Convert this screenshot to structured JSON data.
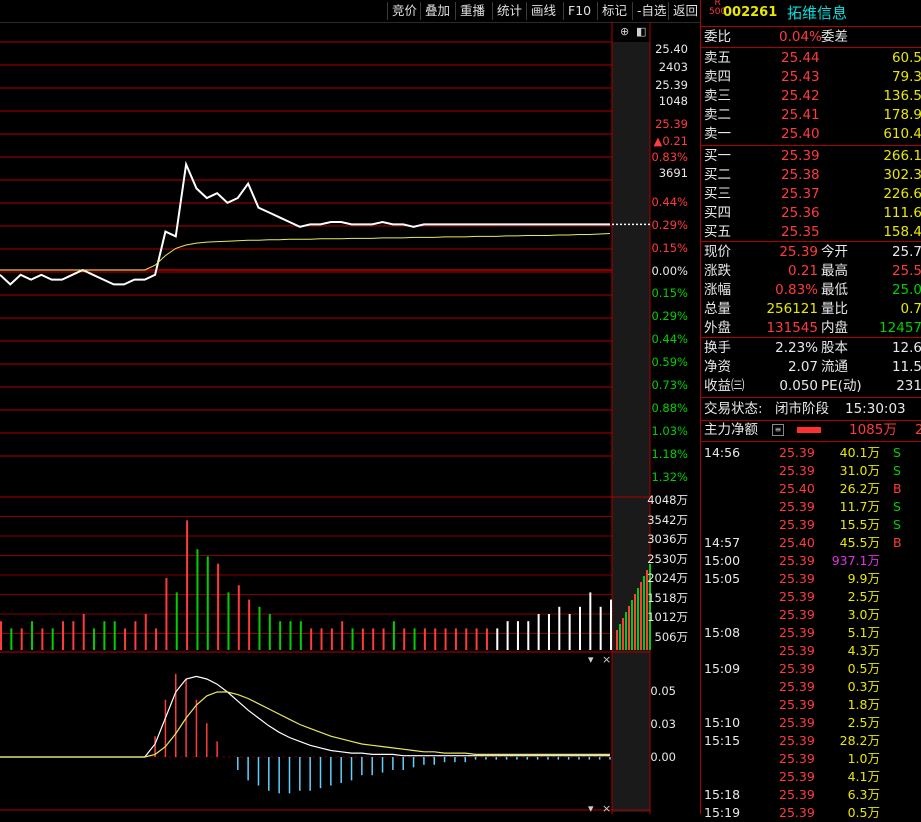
{
  "toolbar": {
    "items": [
      "竞价",
      "叠加",
      "重播",
      "统计",
      "画线",
      "F10",
      "标记",
      "-自选",
      "返回"
    ]
  },
  "stock": {
    "badge_top": "R",
    "badge_bottom": "500",
    "code": "002261",
    "name": "拓维信息"
  },
  "weibi": {
    "label": "委比",
    "value": "0.04%",
    "label2": "委差"
  },
  "asks": [
    {
      "label": "卖五",
      "price": "25.44",
      "vol": "60.5"
    },
    {
      "label": "卖四",
      "price": "25.43",
      "vol": "79.3"
    },
    {
      "label": "卖三",
      "price": "25.42",
      "vol": "136.5"
    },
    {
      "label": "卖二",
      "price": "25.41",
      "vol": "178.9"
    },
    {
      "label": "卖一",
      "price": "25.40",
      "vol": "610.4"
    }
  ],
  "bids": [
    {
      "label": "买一",
      "price": "25.39",
      "vol": "266.1"
    },
    {
      "label": "买二",
      "price": "25.38",
      "vol": "302.3"
    },
    {
      "label": "买三",
      "price": "25.37",
      "vol": "226.6"
    },
    {
      "label": "买四",
      "price": "25.36",
      "vol": "111.6"
    },
    {
      "label": "买五",
      "price": "25.35",
      "vol": "158.4"
    }
  ],
  "quote": [
    {
      "l1": "现价",
      "v1": "25.39",
      "l2": "今开",
      "v2": "25.7",
      "c1": "red",
      "c2": "white"
    },
    {
      "l1": "涨跌",
      "v1": "0.21",
      "l2": "最高",
      "v2": "25.5",
      "c1": "red",
      "c2": "red"
    },
    {
      "l1": "涨幅",
      "v1": "0.83%",
      "l2": "最低",
      "v2": "25.0",
      "c1": "red",
      "c2": "green"
    },
    {
      "l1": "总量",
      "v1": "256121",
      "l2": "量比",
      "v2": "0.7",
      "c1": "yellow",
      "c2": "yellow"
    },
    {
      "l1": "外盘",
      "v1": "131545",
      "l2": "内盘",
      "v2": "12457",
      "c1": "red",
      "c2": "green"
    }
  ],
  "fund": [
    {
      "l1": "换手",
      "v1": "2.23%",
      "l2": "股本",
      "v2": "12.6"
    },
    {
      "l1": "净资",
      "v1": "2.07",
      "l2": "流通",
      "v2": "11.5"
    },
    {
      "l1": "收益㈢",
      "v1": "0.050",
      "l2": "PE(动)",
      "v2": "231"
    }
  ],
  "status": {
    "label": "交易状态:",
    "value": "闭市阶段",
    "time": "15:30:03"
  },
  "mainflow": {
    "label": "主力净额",
    "value": "1085万",
    "extra": "2"
  },
  "ticks": [
    {
      "t": "14:56",
      "p": "25.39",
      "v": "40.1万",
      "bs": "S",
      "pc": "red",
      "vc": "yellow",
      "bc": "green"
    },
    {
      "t": "",
      "p": "25.39",
      "v": "31.0万",
      "bs": "S",
      "pc": "red",
      "vc": "yellow",
      "bc": "green"
    },
    {
      "t": "",
      "p": "25.40",
      "v": "26.2万",
      "bs": "B",
      "pc": "red",
      "vc": "yellow",
      "bc": "red"
    },
    {
      "t": "",
      "p": "25.39",
      "v": "11.7万",
      "bs": "S",
      "pc": "red",
      "vc": "yellow",
      "bc": "green"
    },
    {
      "t": "",
      "p": "25.39",
      "v": "15.5万",
      "bs": "S",
      "pc": "red",
      "vc": "yellow",
      "bc": "green"
    },
    {
      "t": "14:57",
      "p": "25.40",
      "v": "45.5万",
      "bs": "B",
      "pc": "red",
      "vc": "yellow",
      "bc": "red"
    },
    {
      "t": "15:00",
      "p": "25.39",
      "v": "937.1万",
      "bs": "",
      "pc": "red",
      "vc": "magenta",
      "bc": "white"
    },
    {
      "t": "15:05",
      "p": "25.39",
      "v": "9.9万",
      "bs": "",
      "pc": "red",
      "vc": "yellow",
      "bc": "white"
    },
    {
      "t": "",
      "p": "25.39",
      "v": "2.5万",
      "bs": "",
      "pc": "red",
      "vc": "yellow",
      "bc": "white"
    },
    {
      "t": "",
      "p": "25.39",
      "v": "3.0万",
      "bs": "",
      "pc": "red",
      "vc": "yellow",
      "bc": "white"
    },
    {
      "t": "15:08",
      "p": "25.39",
      "v": "5.1万",
      "bs": "",
      "pc": "red",
      "vc": "yellow",
      "bc": "white"
    },
    {
      "t": "",
      "p": "25.39",
      "v": "4.3万",
      "bs": "",
      "pc": "red",
      "vc": "yellow",
      "bc": "white"
    },
    {
      "t": "15:09",
      "p": "25.39",
      "v": "0.5万",
      "bs": "",
      "pc": "red",
      "vc": "yellow",
      "bc": "white"
    },
    {
      "t": "",
      "p": "25.39",
      "v": "0.3万",
      "bs": "",
      "pc": "red",
      "vc": "yellow",
      "bc": "white"
    },
    {
      "t": "",
      "p": "25.39",
      "v": "1.8万",
      "bs": "",
      "pc": "red",
      "vc": "yellow",
      "bc": "white"
    },
    {
      "t": "15:10",
      "p": "25.39",
      "v": "2.5万",
      "bs": "",
      "pc": "red",
      "vc": "yellow",
      "bc": "white"
    },
    {
      "t": "15:15",
      "p": "25.39",
      "v": "28.2万",
      "bs": "",
      "pc": "red",
      "vc": "yellow",
      "bc": "white"
    },
    {
      "t": "",
      "p": "25.39",
      "v": "1.0万",
      "bs": "",
      "pc": "red",
      "vc": "yellow",
      "bc": "white"
    },
    {
      "t": "",
      "p": "25.39",
      "v": "4.1万",
      "bs": "",
      "pc": "red",
      "vc": "yellow",
      "bc": "white"
    },
    {
      "t": "15:18",
      "p": "25.39",
      "v": "6.3万",
      "bs": "",
      "pc": "red",
      "vc": "yellow",
      "bc": "white"
    },
    {
      "t": "15:19",
      "p": "25.39",
      "v": "0.5万",
      "bs": "",
      "pc": "red",
      "vc": "yellow",
      "bc": "white"
    }
  ],
  "price_axis": {
    "labels_right": [
      "25.40",
      "2403",
      "25.39",
      "1048",
      "25.39",
      "▲0.21",
      "0.83%",
      "3691"
    ],
    "pct_up": [
      "0.44%",
      "0.29%",
      "0.15%",
      "0.00%"
    ],
    "pct_down": [
      "0.15%",
      "0.29%",
      "0.44%",
      "0.59%",
      "0.73%",
      "0.88%",
      "1.03%",
      "1.18%",
      "1.32%"
    ]
  },
  "vol_axis": [
    "4048万",
    "3542万",
    "3036万",
    "2530万",
    "2024万",
    "1518万",
    "1012万",
    "506万"
  ],
  "macd_axis": [
    "0.05",
    "0.03",
    "0.00"
  ],
  "chart_data": {
    "type": "line",
    "price_line": [
      -0.1,
      -0.3,
      -0.1,
      -0.2,
      -0.1,
      -0.2,
      -0.2,
      -0.1,
      0.0,
      -0.1,
      -0.2,
      -0.3,
      -0.3,
      -0.2,
      -0.2,
      -0.1,
      0.8,
      0.7,
      2.2,
      1.7,
      1.5,
      1.6,
      1.4,
      1.5,
      1.8,
      1.3,
      1.2,
      1.1,
      1.0,
      0.9,
      0.95,
      0.95,
      1.0,
      1.0,
      0.95,
      0.95,
      0.95,
      1.0,
      0.95,
      0.95,
      0.9,
      0.95,
      0.95,
      0.95,
      0.95,
      0.95,
      0.95,
      0.95,
      0.95,
      0.95,
      0.95,
      0.95,
      0.95,
      0.95,
      0.95,
      0.95,
      0.95,
      0.95,
      0.95,
      0.95
    ],
    "avg_line": [
      0.0,
      0.0,
      0.0,
      0.0,
      0.0,
      0.0,
      0.0,
      0.0,
      0.0,
      0.0,
      0.0,
      0.0,
      0.0,
      0.0,
      0.0,
      0.1,
      0.3,
      0.45,
      0.52,
      0.56,
      0.58,
      0.59,
      0.6,
      0.61,
      0.62,
      0.62,
      0.63,
      0.63,
      0.64,
      0.64,
      0.64,
      0.65,
      0.65,
      0.65,
      0.66,
      0.66,
      0.66,
      0.67,
      0.67,
      0.67,
      0.68,
      0.68,
      0.68,
      0.69,
      0.69,
      0.69,
      0.7,
      0.7,
      0.7,
      0.71,
      0.71,
      0.72,
      0.72,
      0.72,
      0.73,
      0.73,
      0.74,
      0.74,
      0.75,
      0.76
    ],
    "volume": [
      4,
      3,
      3,
      4,
      3,
      3,
      4,
      4,
      5,
      3,
      4,
      4,
      3,
      4,
      5,
      3,
      10,
      8,
      18,
      14,
      13,
      12,
      8,
      9,
      7,
      6,
      5,
      4,
      4,
      4,
      3,
      3,
      3,
      4,
      3,
      3,
      3,
      3,
      4,
      3,
      3,
      3,
      3,
      3,
      3,
      3,
      3,
      3,
      3,
      4,
      4,
      4,
      5,
      5,
      6,
      5,
      6,
      8,
      6,
      7
    ],
    "macd_dif": [
      0,
      0,
      0,
      0,
      0,
      0,
      0,
      0,
      0,
      0,
      0,
      0,
      0,
      0,
      0,
      0.01,
      0.03,
      0.05,
      0.06,
      0.062,
      0.06,
      0.056,
      0.05,
      0.043,
      0.036,
      0.03,
      0.024,
      0.019,
      0.015,
      0.012,
      0.009,
      0.007,
      0.005,
      0.004,
      0.003,
      0.003,
      0.002,
      0.002,
      0.002,
      0.001,
      0.001,
      0.001,
      0.001,
      0.001,
      0.001,
      0.001,
      0.001,
      0.001,
      0.001,
      0.001,
      0.001,
      0.001,
      0.001,
      0.001,
      0.001,
      0.001,
      0.001,
      0.001,
      0.001,
      0.001
    ],
    "macd_dea": [
      0,
      0,
      0,
      0,
      0,
      0,
      0,
      0,
      0,
      0,
      0,
      0,
      0,
      0,
      0,
      0.002,
      0.008,
      0.018,
      0.03,
      0.04,
      0.047,
      0.05,
      0.05,
      0.048,
      0.045,
      0.041,
      0.037,
      0.033,
      0.029,
      0.025,
      0.022,
      0.019,
      0.016,
      0.014,
      0.012,
      0.01,
      0.009,
      0.008,
      0.007,
      0.006,
      0.005,
      0.004,
      0.004,
      0.003,
      0.003,
      0.003,
      0.002,
      0.002,
      0.002,
      0.002,
      0.002,
      0.002,
      0.002,
      0.002,
      0.002,
      0.002,
      0.002,
      0.002,
      0.002,
      0.002
    ]
  }
}
